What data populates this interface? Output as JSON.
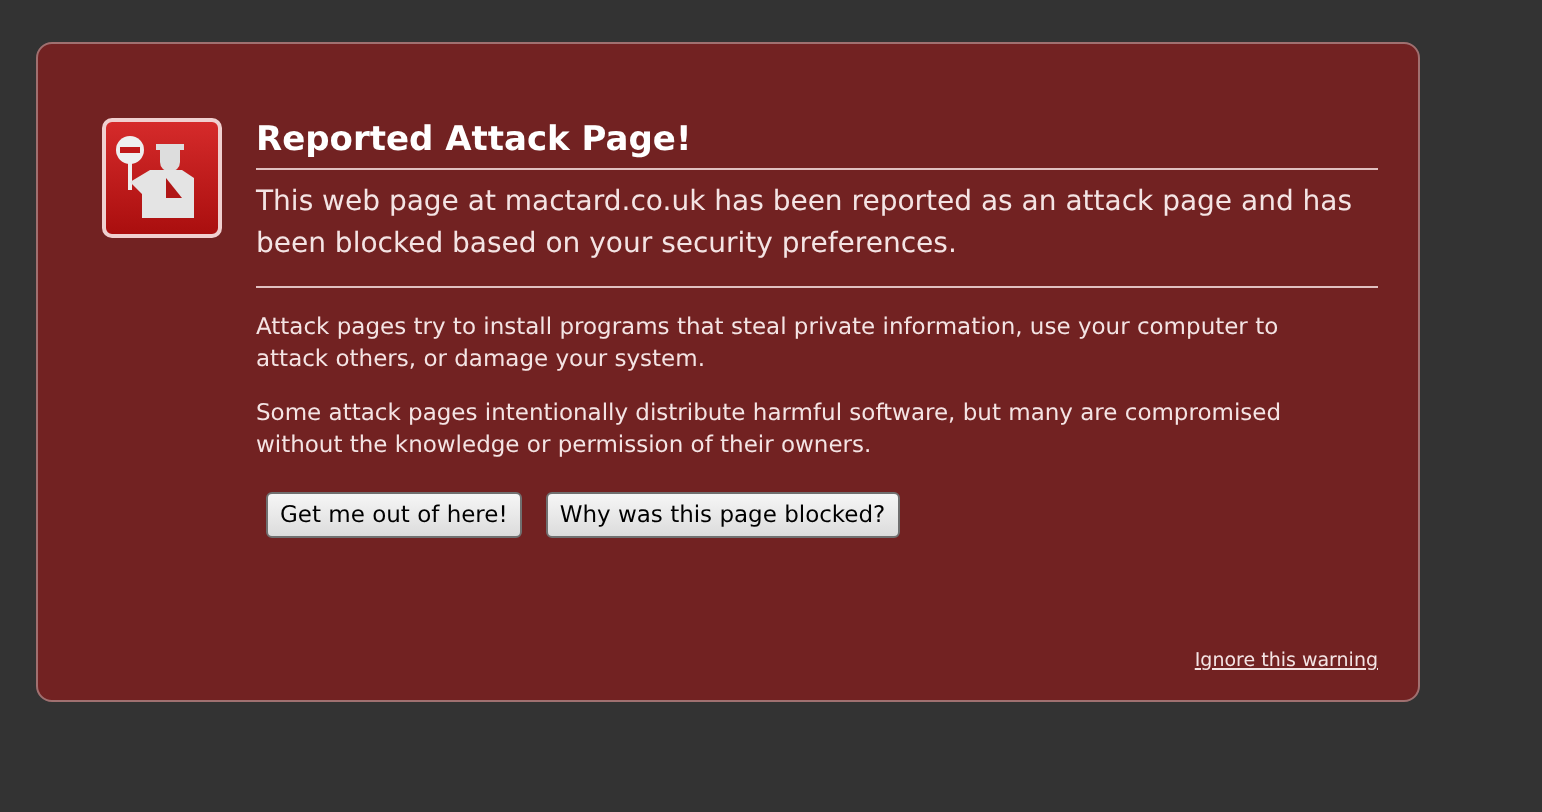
{
  "title": "Reported Attack Page!",
  "lead": "This web page at mactard.co.uk has been reported as an attack page and has been blocked based on your security preferences.",
  "paragraphs": [
    "Attack pages try to install programs that steal private information, use your computer to attack others, or damage your system.",
    "Some attack pages intentionally distribute harmful software, but many are compromised without the knowledge or permission of their owners."
  ],
  "buttons": [
    "Get me out of here!",
    "Why was this page blocked?"
  ],
  "ignore_link": "Ignore this warning"
}
